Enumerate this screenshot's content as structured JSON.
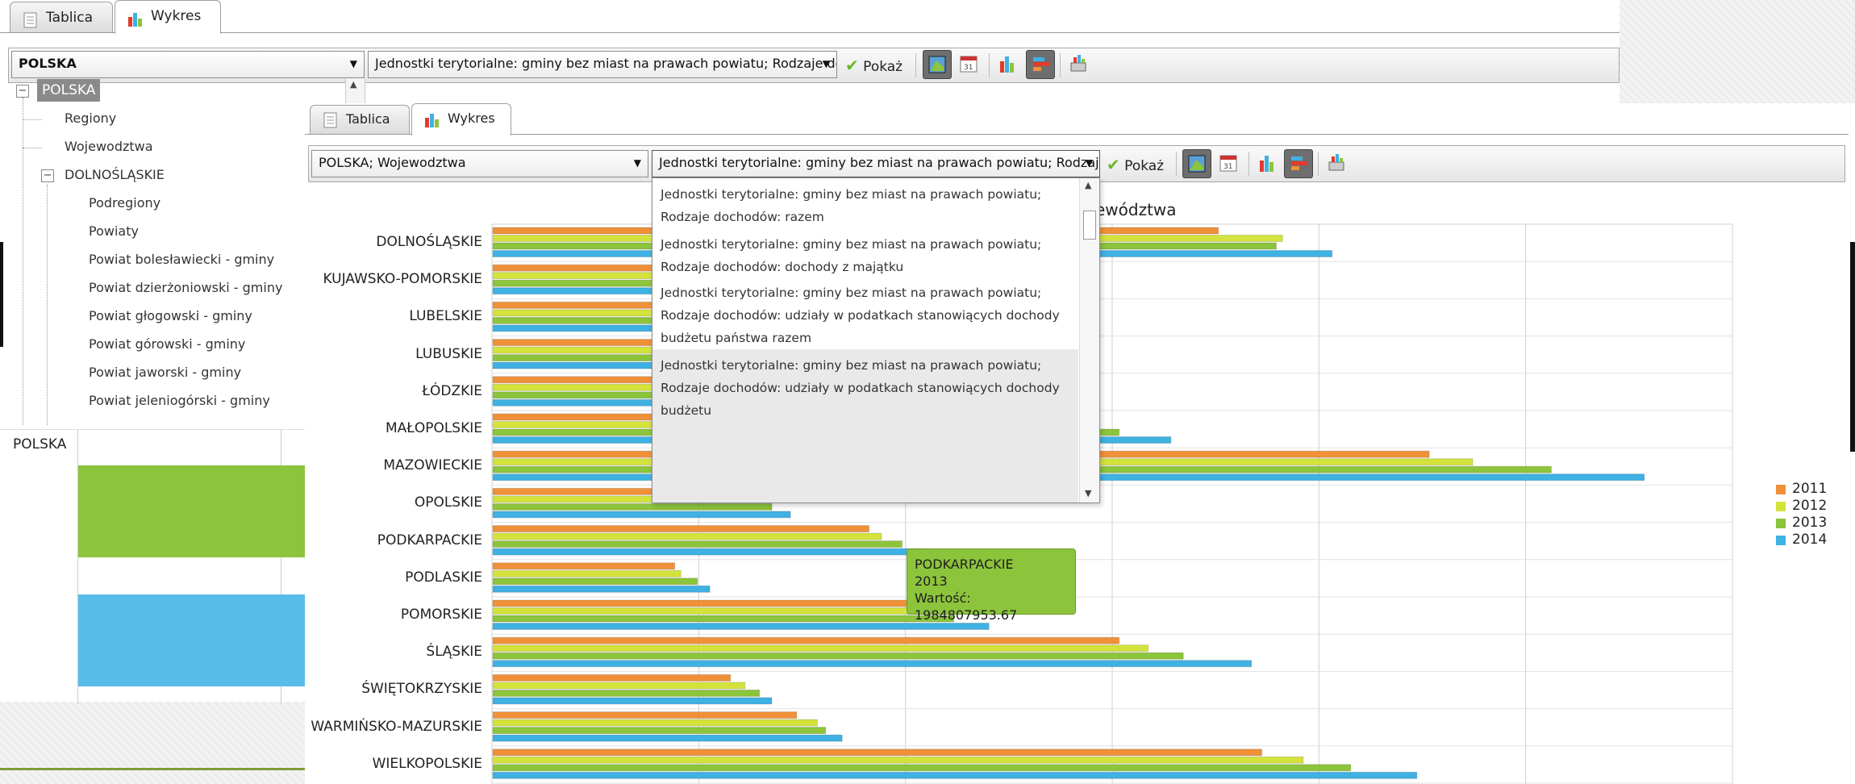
{
  "colors": {
    "s2011": "#f0913a",
    "s2012": "#d4e33c",
    "s2013": "#8cc43c",
    "s2014": "#3fb1e3",
    "tooltip_bg": "#8cc43c"
  },
  "outer": {
    "tabs": [
      {
        "label": "Tablica",
        "icon": "table-icon"
      },
      {
        "label": "Wykres",
        "icon": "bar-chart-icon"
      }
    ],
    "region_select": "POLSKA",
    "variable_select": "Jednostki terytorialne: gminy bez miast na prawach powiatu; Rodzaje dc",
    "show_label": "Pokaż",
    "tree": {
      "root": "POLSKA",
      "items": [
        "Regiony",
        "Wojewodztwa",
        "DOLNOŚLĄSKIE",
        "Podregiony",
        "Powiaty",
        "Powiat bolesławiecki - gminy",
        "Powiat dzierżoniowski - gminy",
        "Powiat głogowski - gminy",
        "Powiat górowski - gminy",
        "Powiat jaworski - gminy",
        "Powiat jeleniogórski - gminy"
      ]
    },
    "bg_chart_label": "POLSKA"
  },
  "inner": {
    "tabs": [
      {
        "label": "Tablica",
        "icon": "table-icon"
      },
      {
        "label": "Wykres",
        "icon": "bar-chart-icon"
      }
    ],
    "region_select": "POLSKA; Wojewodztwa",
    "variable_select": "Jednostki terytorialne: gminy bez miast na prawach powiatu; Rodzaje dc",
    "show_label": "Pokaż",
    "dropdown": [
      "Jednostki terytorialne: gminy bez miast na prawach powiatu; Rodzaje dochodów: razem",
      "Jednostki terytorialne: gminy bez miast na prawach powiatu; Rodzaje dochodów: dochody z majątku",
      "Jednostki terytorialne: gminy bez miast na prawach powiatu; Rodzaje dochodów: udziały w podatkach stanowiących dochody budżetu państwa razem",
      "Jednostki terytorialne: gminy bez miast na prawach powiatu; Rodzaje dochodów: udziały w podatkach stanowiących dochody budżetu"
    ],
    "chart_title_fragment": "ewództwa"
  },
  "tooltip": {
    "line1": "PODKARPACKIE",
    "line2": "2013",
    "line3": "Wartość: 1984807953.67"
  },
  "chart_data": {
    "type": "bar",
    "orientation": "horizontal",
    "title": "",
    "categories": [
      "DOLNOŚLĄSKIE",
      "KUJAWSKO-POMORSKIE",
      "LUBELSKIE",
      "LUBUSKIE",
      "ŁÓDZKIE",
      "MAŁOPOLSKIE",
      "MAZOWIECKIE",
      "OPOLSKIE",
      "PODKARPACKIE",
      "PODLASKIE",
      "POMORSKIE",
      "ŚLĄSKIE",
      "ŚWIĘTOKRZYSKIE",
      "WARMIŃSKO-MAZURSKIE",
      "WIELKOPOLSKIE"
    ],
    "series": [
      {
        "name": "2011",
        "values": [
          3.51,
          2.0,
          2.3,
          1.2,
          2.5,
          2.73,
          4.53,
          1.19,
          1.82,
          0.88,
          2.08,
          3.03,
          1.15,
          1.47,
          3.72
        ]
      },
      {
        "name": "2012",
        "values": [
          3.82,
          2.1,
          2.4,
          1.3,
          2.55,
          2.83,
          4.74,
          1.28,
          1.88,
          0.91,
          2.1,
          3.17,
          1.22,
          1.57,
          3.92
        ]
      },
      {
        "name": "2013",
        "values": [
          3.79,
          2.2,
          2.5,
          1.35,
          2.62,
          3.03,
          5.12,
          1.35,
          1.98,
          0.99,
          2.23,
          3.34,
          1.29,
          1.61,
          4.15
        ]
      },
      {
        "name": "2014",
        "values": [
          4.06,
          2.3,
          2.6,
          1.45,
          2.92,
          3.28,
          5.57,
          1.44,
          2.1,
          1.05,
          2.4,
          3.67,
          1.35,
          1.69,
          4.47
        ]
      }
    ],
    "xlim": [
      0,
      6.0
    ],
    "grid": true,
    "legend": "right"
  }
}
